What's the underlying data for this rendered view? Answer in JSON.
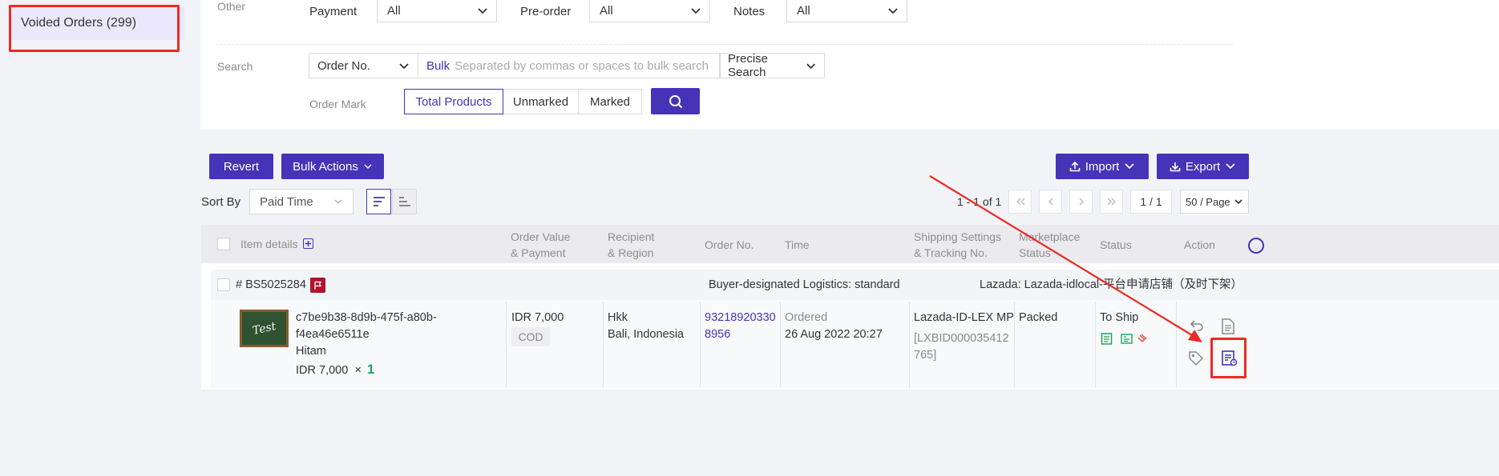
{
  "sidebar": {
    "voided_orders": "Voided Orders (299)"
  },
  "filters": {
    "other_label": "Other",
    "payment_label": "Payment",
    "payment_value": "All",
    "preorder_label": "Pre-order",
    "preorder_value": "All",
    "notes_label": "Notes",
    "notes_value": "All",
    "search_label": "Search",
    "search_type": "Order No.",
    "bulk": "Bulk",
    "search_placeholder": "Separated by commas or spaces to bulk search",
    "precise": "Precise Search",
    "order_mark_label": "Order Mark",
    "marks": [
      "Total Products",
      "Unmarked",
      "Marked"
    ]
  },
  "toolbar": {
    "revert": "Revert",
    "bulk_actions": "Bulk Actions",
    "import": "Import",
    "export": "Export",
    "sort_by": "Sort By",
    "sort_value": "Paid Time",
    "range": "1 - 1 of 1",
    "page_input": "1 / 1",
    "page_size": "50 / Page"
  },
  "table": {
    "headers": {
      "item": "Item details",
      "value": [
        "Order Value",
        "& Payment"
      ],
      "recipient": [
        "Recipient",
        "& Region"
      ],
      "order_no": "Order No.",
      "time": "Time",
      "shipping": [
        "Shipping Settings",
        "& Tracking No."
      ],
      "marketplace": [
        "Marketplace",
        "Status"
      ],
      "status": "Status",
      "action": "Action"
    }
  },
  "order": {
    "id": "# BS5025284",
    "logistics": "Buyer-designated Logistics: standard",
    "store": "Lazada: Lazada-idlocal-平台申请店铺（及时下架）",
    "thumb_text": "Test",
    "product_name_1": "c7be9b38-8d9b-475f-a80b-",
    "product_name_2": "f4ea46e6511e",
    "variant": "Hitam",
    "item_price": "IDR 7,000",
    "times": "×",
    "qty": "1",
    "order_value": "IDR 7,000",
    "payment": "COD",
    "recipient": "Hkk",
    "region": "Bali, Indonesia",
    "order_no_1": "93218920330",
    "order_no_2": "8956",
    "time_label": "Ordered",
    "time_value": "26 Aug 2022 20:27",
    "carrier": "Lazada-ID-LEX MP",
    "tracking_open": "[",
    "tracking_1": "LXBID000035412",
    "tracking_2": "765",
    "tracking_close": "]",
    "marketplace_status": "Packed",
    "status": "To Ship"
  },
  "colors": {
    "accent": "#4633b8",
    "highlight": "#ee2a24",
    "green": "#1aa85c"
  }
}
